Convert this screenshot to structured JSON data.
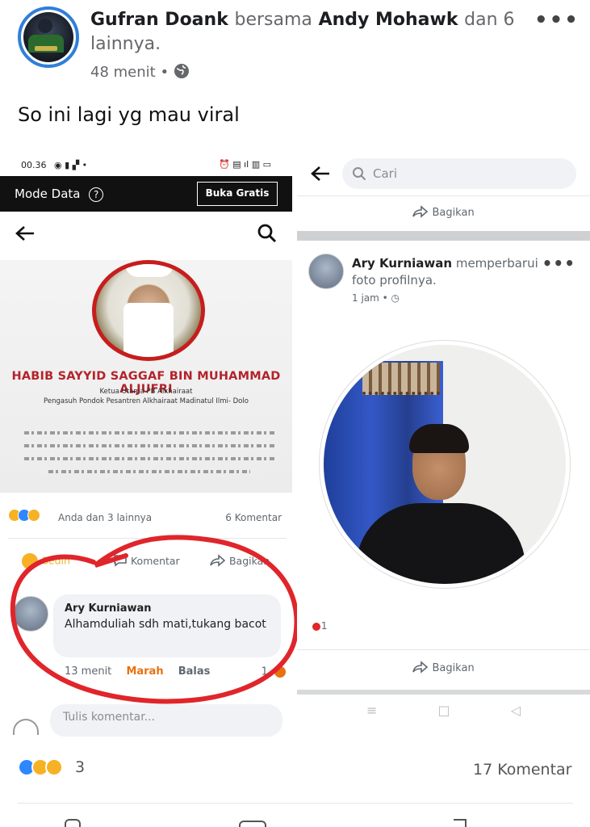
{
  "post": {
    "author": "Gufran Doank",
    "with_word": "bersama",
    "tagged": "Andy Mohawk",
    "and_others": "dan 6 lainnya.",
    "time": "48 menit",
    "text": "So ini lagi yg mau viral",
    "reaction_count": "3",
    "comments_count": "17 Komentar"
  },
  "left_screen": {
    "status_time": "00.36",
    "mode_data_label": "Mode Data",
    "buka_gratis_label": "Buka Gratis",
    "banner_title": "HABIB SAYYID SAGGAF BIN MUHAMMAD ALJUFRI",
    "banner_sub1": "Ketua Utama PB Alkhairaat",
    "banner_sub2": "Pengasuh Pondok Pesantren Alkhairaat Madinatul Ilmi- Dolo",
    "reactions_text": "Anda dan 3 lainnya",
    "comments_count": "6 Komentar",
    "action_sad": "Sedih",
    "action_comment": "Komentar",
    "action_share": "Bagikan",
    "comment": {
      "author": "Ary Kurniawan",
      "text": "Alhamduliah sdh mati,tukang bacot",
      "time": "13 menit",
      "reaction_label": "Marah",
      "reply_label": "Balas",
      "reaction_count": "1"
    },
    "compose_placeholder": "Tulis komentar..."
  },
  "right_screen": {
    "search_placeholder": "Cari",
    "share_label": "Bagikan",
    "author": "Ary Kurniawan",
    "update_text": "memperbarui foto profilnya.",
    "time": "1 jam",
    "reaction_count": "1"
  },
  "colors": {
    "brand_blue": "#1877f2",
    "annotation_red": "#e0252b",
    "banner_red": "#b3232c",
    "marah_orange": "#e9710f"
  }
}
